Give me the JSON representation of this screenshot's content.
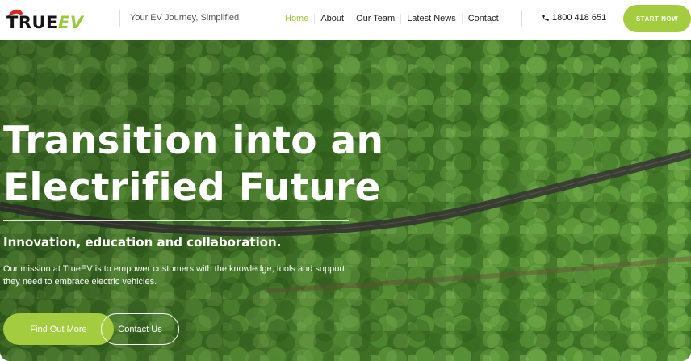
{
  "header": {
    "logo": {
      "text_main": "TRUE",
      "text_accent": "EV"
    },
    "tagline": "Your EV Journey, Simplified",
    "nav": [
      {
        "label": "Home",
        "active": true
      },
      {
        "label": "About",
        "active": false
      },
      {
        "label": "Our Team",
        "active": false
      },
      {
        "label": "Latest News",
        "active": false
      },
      {
        "label": "Contact",
        "active": false
      }
    ],
    "phone": {
      "icon": "phone-icon",
      "number": "1800 418 651"
    },
    "cta": "START NOW"
  },
  "hero": {
    "title_line1": "Transition into an",
    "title_line2": "Electrified Future",
    "subtitle": "Innovation, education and collaboration.",
    "description": "Our mission at TrueEV is to empower customers with the knowledge, tools and support they need to embrace electric vehicles.",
    "primary_button": "Find Out More",
    "secondary_button": "Contact Us"
  },
  "colors": {
    "accent": "#a3cc3f",
    "nav_active": "#9bc93b",
    "text_dark": "#222222",
    "hero_text": "#ffffff"
  }
}
